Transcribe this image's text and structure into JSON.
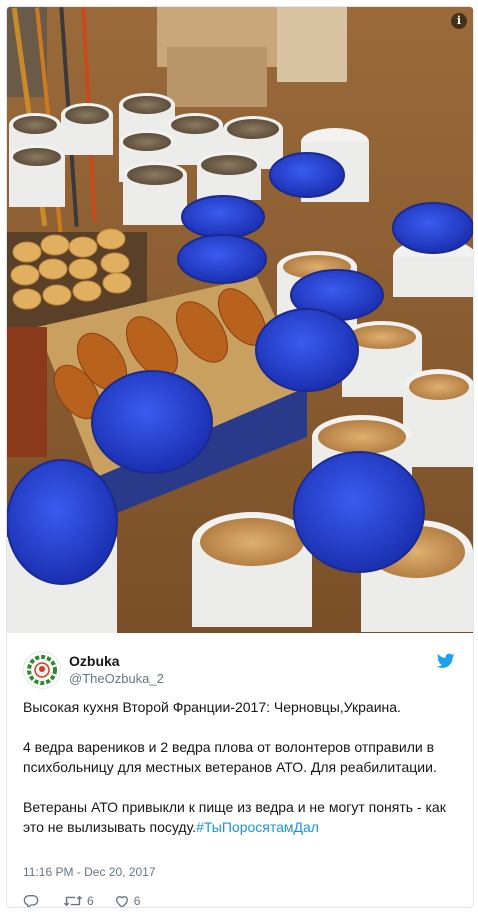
{
  "media": {
    "info_label": "i"
  },
  "author": {
    "name": "Ozbuka",
    "handle": "@TheOzbuka_2"
  },
  "tweet": {
    "line1": "Высокая кухня Второй Франции-2017: Черновцы,Украина.",
    "para2": "4 ведра вареников и 2 ведра плова от волонтеров отправили в психбольницу для местных ветеранов АТО. Для реабилитации.",
    "para3_text": "Ветераны АТО привыкли к пище из ведра и не могут понять - как это не вылизывать посуду.",
    "hashtag": "#ТыПоросятамДал"
  },
  "timestamp": "11:16 PM - Dec 20, 2017",
  "actions": {
    "reply_count": "",
    "retweet_count": "6",
    "like_count": "6"
  },
  "colors": {
    "link": "#1b95e0",
    "secondary_text": "#657786",
    "lid_blue": "#1f3fd0"
  }
}
